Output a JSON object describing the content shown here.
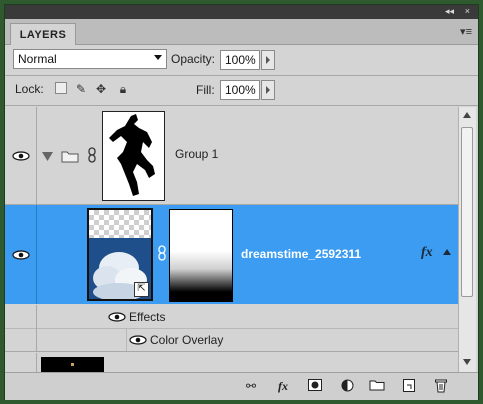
{
  "panel": {
    "tab_label": "LAYERS",
    "collapse_glyph": "◂◂",
    "close_glyph": "×",
    "menu_glyph": "▾≡"
  },
  "options": {
    "blend_mode": "Normal",
    "opacity_label": "Opacity:",
    "opacity_value": "100%",
    "lock_label": "Lock:",
    "fill_label": "Fill:",
    "fill_value": "100%"
  },
  "layers": {
    "group": {
      "name": "Group 1",
      "expanded": true
    },
    "selected": {
      "name": "dreamstime_2592311",
      "fx_label": "fx"
    },
    "effects_label": "Effects",
    "effect_items": [
      "Color Overlay"
    ]
  },
  "bottom_icons": [
    "link-icon",
    "fx-icon",
    "mask-icon",
    "adjustment-icon",
    "folder-icon",
    "new-layer-icon",
    "trash-icon"
  ],
  "colors": {
    "selection": "#3b9cf2",
    "frame": "#2f5a2f"
  }
}
